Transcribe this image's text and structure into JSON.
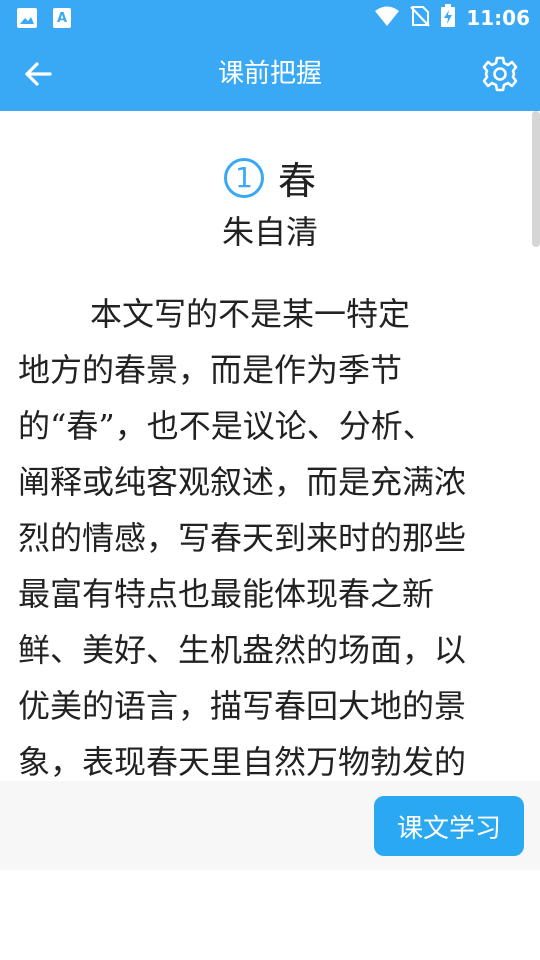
{
  "status_bar": {
    "time": "11:06",
    "left_icons": [
      "gallery-icon",
      "text-app-icon"
    ],
    "right_icons": [
      "wifi-icon",
      "no-sim-icon",
      "battery-charging-icon"
    ]
  },
  "toolbar": {
    "title": "课前把握",
    "back_icon": "arrow-left-icon",
    "settings_icon": "gear-icon"
  },
  "lesson": {
    "number": "1",
    "title": "春",
    "author": "朱自清",
    "lines": [
      "本文写的不是某一特定",
      "地方的春景，而是作为季节",
      "的“春”，也不是议论、分析、",
      "阐释或纯客观叙述，而是充满浓",
      "烈的情感，写春天到来时的那些",
      "最富有特点也最能体现春之新",
      "鲜、美好、生机盎然的场面，以",
      "优美的语言，描写春回大地的景",
      "象，表现春天里自然万物勃发的"
    ]
  },
  "bottom": {
    "study_button": "课文学习"
  },
  "colors": {
    "primary": "#3aa9f5",
    "button": "#2aa9f2",
    "text": "#222222"
  }
}
